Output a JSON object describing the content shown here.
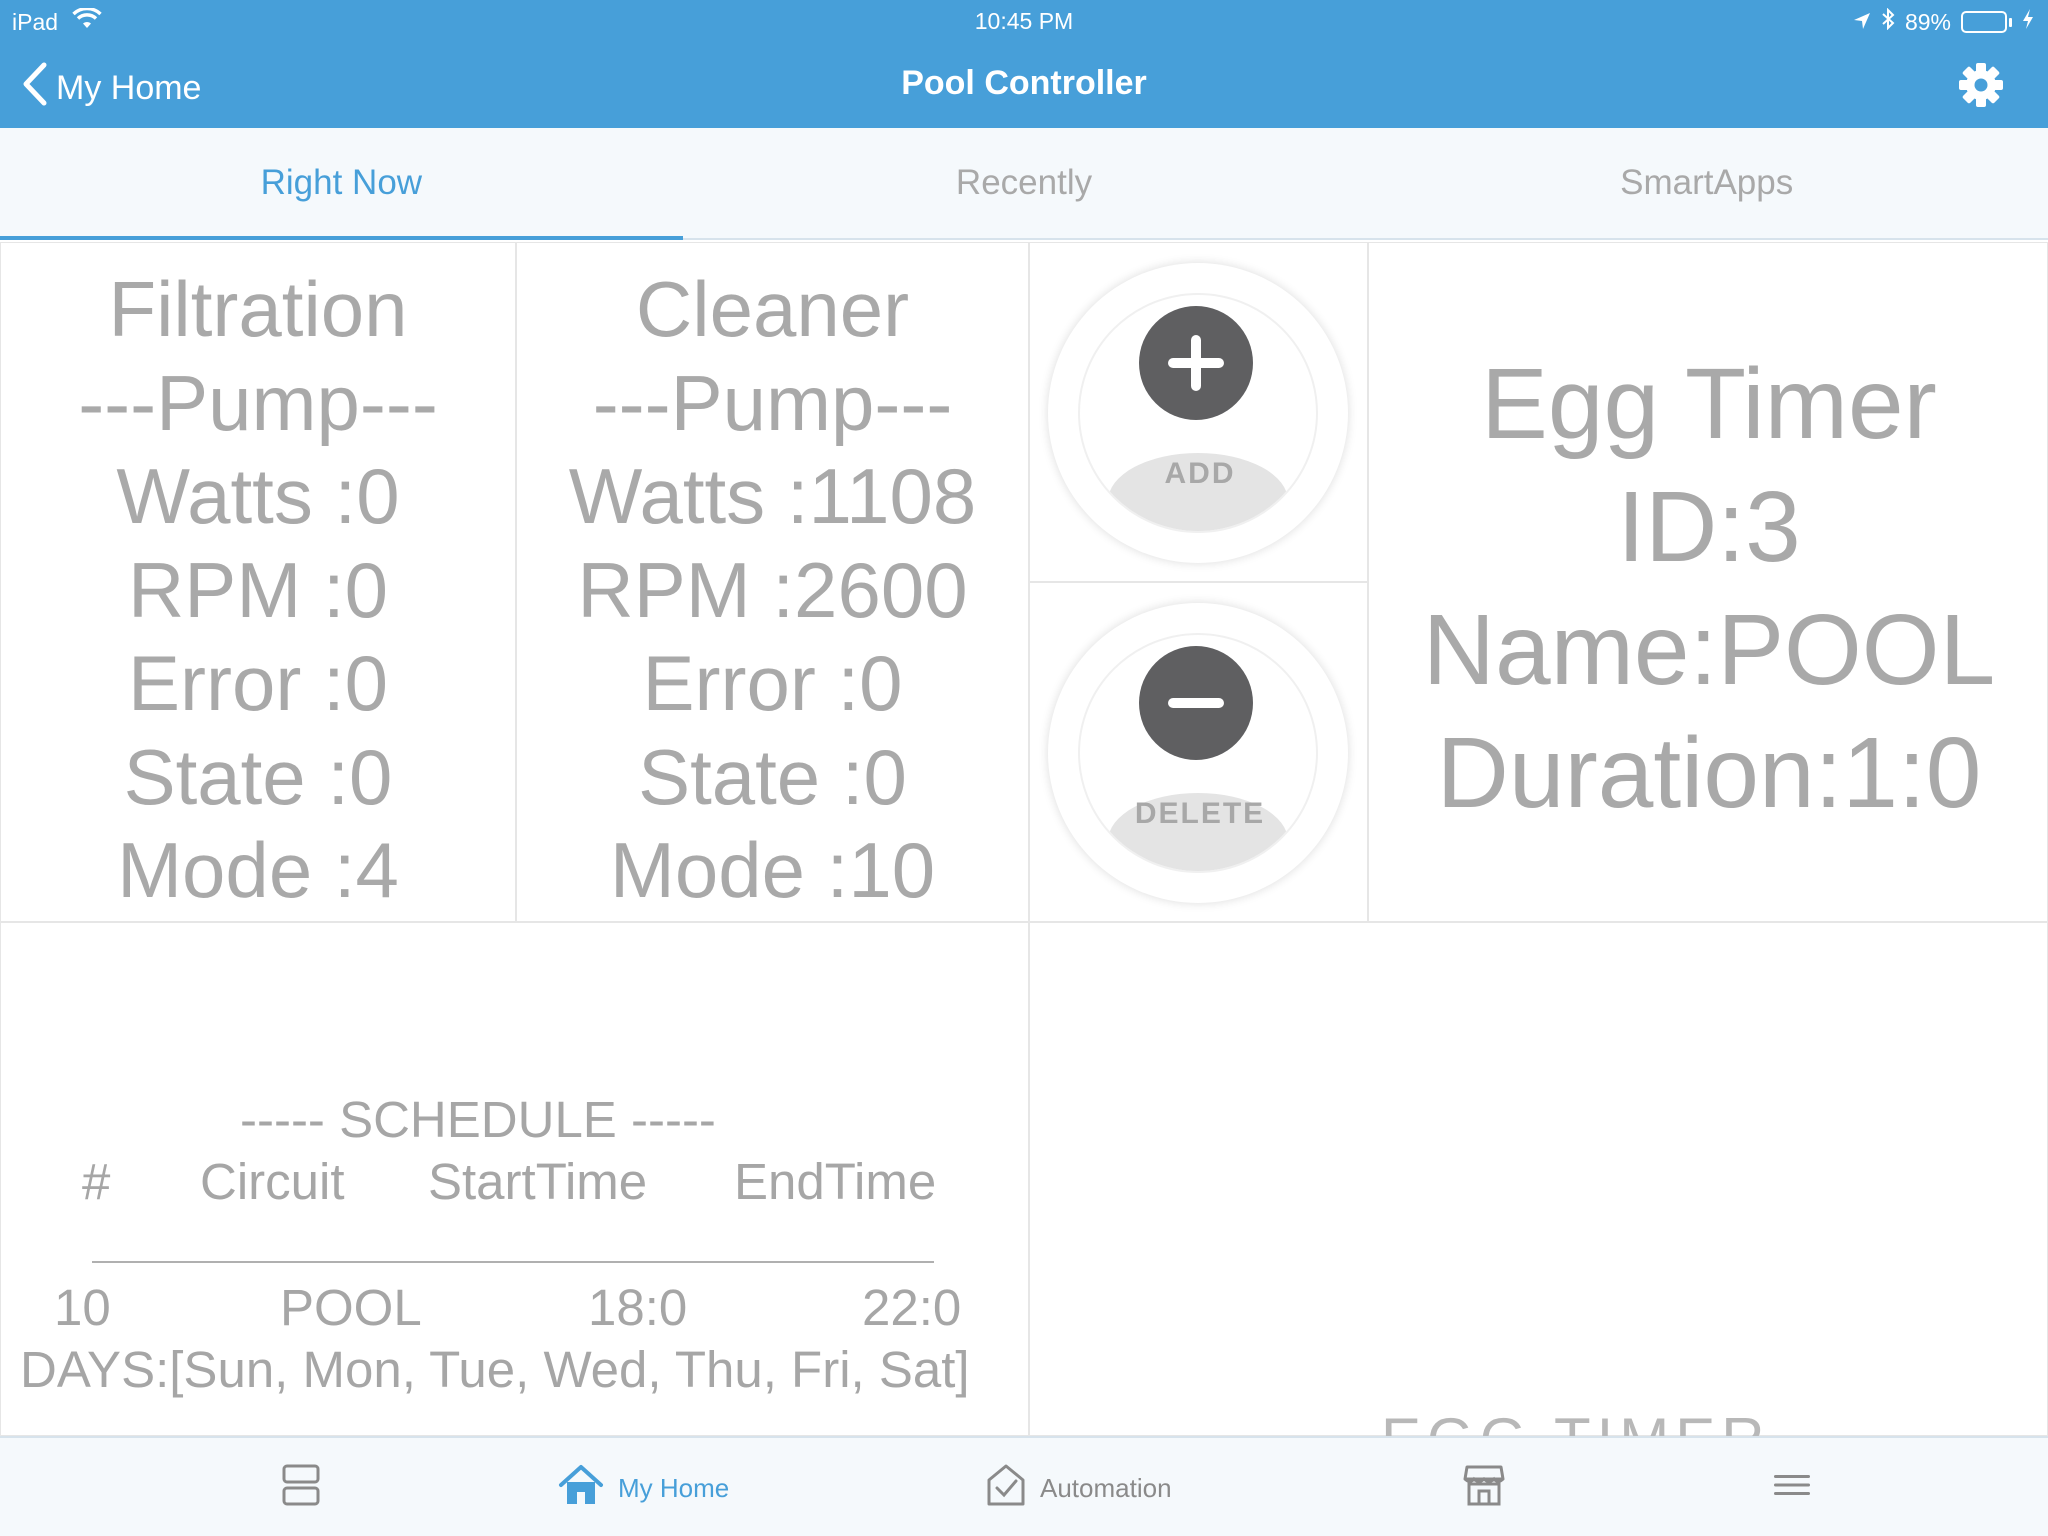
{
  "status_bar": {
    "device": "iPad",
    "time": "10:45 PM",
    "battery": "89%",
    "battery_level": 0.89
  },
  "nav": {
    "back_label": "My Home",
    "title": "Pool Controller"
  },
  "tabs": [
    {
      "label": "Right Now",
      "active": true
    },
    {
      "label": "Recently",
      "active": false
    },
    {
      "label": "SmartApps",
      "active": false
    }
  ],
  "filtration_pump": {
    "line1": "Filtration",
    "line2": "---Pump---",
    "watts": "Watts :0",
    "rpm": "RPM :0",
    "error": "Error :0",
    "state": "State :0",
    "mode": "Mode :4"
  },
  "cleaner_pump": {
    "line1": "Cleaner",
    "line2": "---Pump---",
    "watts": "Watts :1108",
    "rpm": "RPM :2600",
    "error": "Error :0",
    "state": "State :0",
    "mode": "Mode :10"
  },
  "buttons": {
    "add_label": "ADD",
    "delete_label": "DELETE"
  },
  "egg_timer": {
    "title": "Egg Timer",
    "id": "ID:3",
    "name": "Name:POOL",
    "duration": "Duration:1:0",
    "footer_partial": "EGG TIMER"
  },
  "schedule": {
    "heading": "----- SCHEDULE -----",
    "col_num": "#",
    "col_circuit": "Circuit",
    "col_start": "StartTime",
    "col_end": "EndTime",
    "row_num": "10",
    "row_circuit": "POOL",
    "row_start": "18:0",
    "row_end": "22:0",
    "days": "DAYS:[Sun, Mon, Tue, Wed, Thu, Fri, Sat]"
  },
  "bottom_bar": {
    "my_home": "My Home",
    "automation": "Automation"
  },
  "colors": {
    "accent": "#479fd9",
    "tile_text": "#a9a9a9",
    "icon_dark": "#5f5f61"
  }
}
